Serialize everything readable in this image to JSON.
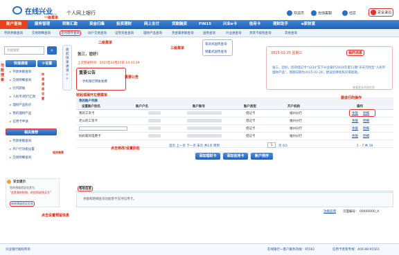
{
  "header": {
    "logo_text": "在线兴业",
    "logo_sub": "ONLINE INDUSTRIAL BANK",
    "bank_name": "个人网上银行",
    "links": [
      "欢迎页",
      "在线客服",
      "社区",
      "安全退出"
    ]
  },
  "nav": {
    "items": [
      "账户查询",
      "服务管理",
      "转账汇款",
      "资金归集",
      "投资理财",
      "网上支付",
      "贷款融资",
      "FIN15",
      "兴业e卡",
      "信用卡",
      "理财助手",
      "e家财富"
    ],
    "active_index": 0
  },
  "subnav": {
    "items": [
      "存款余额查询",
      "交易明细查询",
      "定时转存查询",
      "动户交易查询",
      "证券资金查询",
      "理财产品查询",
      "贵金属余额查询",
      "国债查询",
      "兴业通查询",
      "贵宾卡级别查询",
      "其他查询"
    ]
  },
  "sidebar": {
    "search_placeholder": "功能搜索",
    "quick_title": "快速通道",
    "settings_label": "设置",
    "quick_items": [
      "存款余额查询",
      "交易明细查询",
      "行内转账",
      "人民币/跨行汇款",
      "理财产品购买",
      "我的理财产品",
      "信用卡申请"
    ],
    "related_title": "相关推荐",
    "related_items": [
      "存款余额查询",
      "开户行功能设置",
      "交易明细查询"
    ],
    "tips_title": "安全提示",
    "tips_body_1": "您的预留验证信息为",
    "tips_body_2": "\"会是我的财朋，的信同说快买号\"",
    "tips_link": "修改预留验证信息"
  },
  "collapse": {
    "text": "收起快速通道<<"
  },
  "main": {
    "welcome": "张三，您好！",
    "last_login": "上次登录时间：2015年02月25日 14:33:29",
    "notice_title": "重要公告",
    "notice_item": "手机银行转账免费"
  },
  "dropdown": {
    "items": [
      "笔试式国债查询",
      "储蓄式国债查询"
    ]
  },
  "messages": {
    "date": "2015-02-25 星期三",
    "label": "我的消息",
    "body": "张三，您好，您的借记卡*1234\"实下兴业银行2014年第51期\"天天万利宝\"人民币理财产品\"，到期日期为2015-02-26，建议您继续购买或续期。",
    "more": "查看更多消息信息"
  },
  "table": {
    "title": "我的账户列表",
    "headers": [
      "设置账户别名",
      "账户户名",
      "账户账号",
      "账户类型",
      "开户机构",
      "操作"
    ],
    "rows": [
      {
        "alias": "我的工资卡",
        "type": "借记卡",
        "branch": "福州分行",
        "ops": [
          "余额",
          "明细"
        ]
      },
      {
        "alias": "老公的工资卡",
        "type": "借记卡",
        "branch": "福州分行",
        "ops": [
          "余额",
          "明细"
        ]
      },
      {
        "alias": "",
        "type": "借记卡",
        "branch": "福州分行",
        "ops": [
          "余额",
          "明细"
        ]
      },
      {
        "alias": "妈妈家的电费卡",
        "type": "借记卡",
        "branch": "福州分行",
        "ops": [
          "余额",
          "明细"
        ]
      },
      {
        "alias": "",
        "type": "借记卡",
        "branch": "福州分行",
        "ops": [
          "余额",
          "明细"
        ]
      }
    ],
    "pager": "首页 上一页 下一页 末页 共1页 转到",
    "page_value": "1",
    "page_go": "页 GO",
    "page_total": "1 - 7 共 19",
    "buttons": [
      "添加理财卡",
      "添加信用卡",
      "账户排序"
    ]
  },
  "help": {
    "title": "帮助信息",
    "text": "余额和明细查询功能暂不支持信用卡。",
    "feedback": "功能反馈",
    "page_no": "页面编号： 00000000_A"
  },
  "footer": {
    "left": "兴业银行版权所有",
    "hotline_1": "在线银行一客户服务热线：95561",
    "hotline_2": "信用卡贵宾专线：400-88-95561"
  },
  "annotations": {
    "l1": "一级菜单",
    "l2": "二级菜单",
    "l3": "三级菜单",
    "search": "功能搜索",
    "collapse": "收起或展开左侧菜单",
    "quick": "快速通道设置",
    "tips": "点击设置预留信息",
    "alias": "点击修改/设置别名",
    "ops": "要进行的操作",
    "msg": "我的消息",
    "notice": "重要公告",
    "related": "相关推荐"
  }
}
